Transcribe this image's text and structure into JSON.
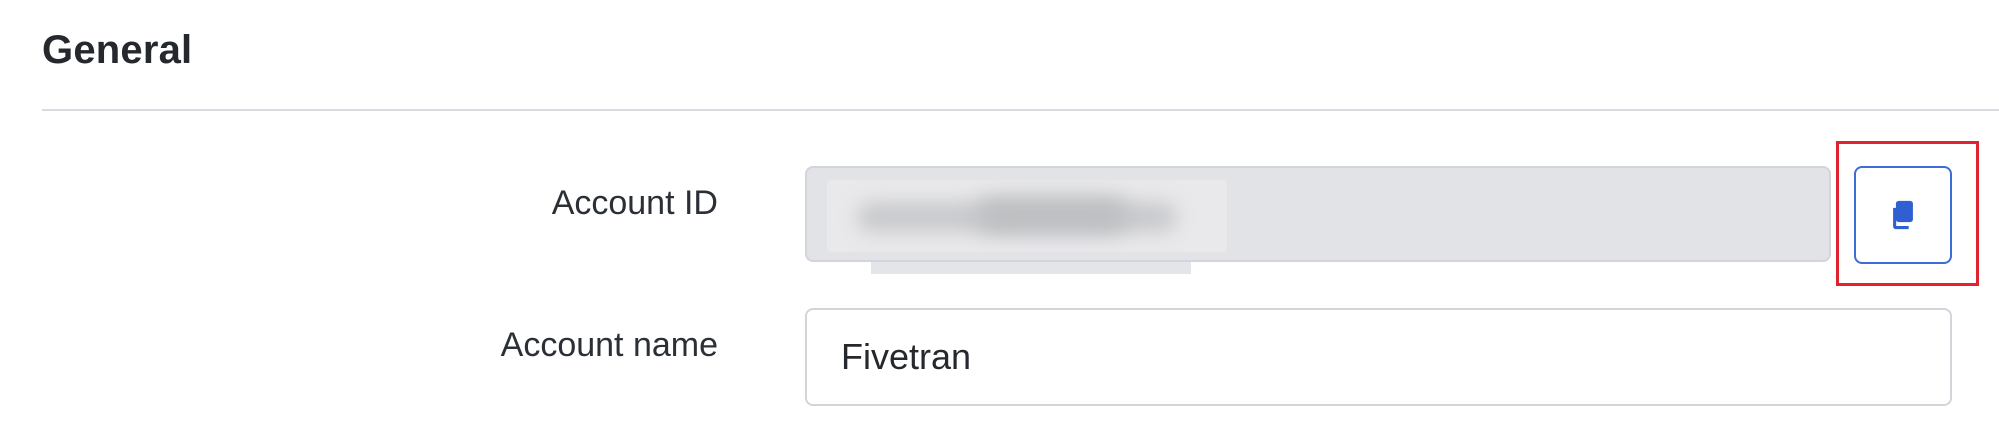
{
  "section": {
    "title": "General"
  },
  "fields": {
    "account_id": {
      "label": "Account ID",
      "value": "",
      "masked": true
    },
    "account_name": {
      "label": "Account name",
      "value": "Fivetran"
    }
  },
  "copy_button": {
    "icon": "copy-icon",
    "icon_color": "#2f5fd0",
    "border_color": "#3e6cd6"
  },
  "highlight": {
    "color": "#e0242f"
  }
}
